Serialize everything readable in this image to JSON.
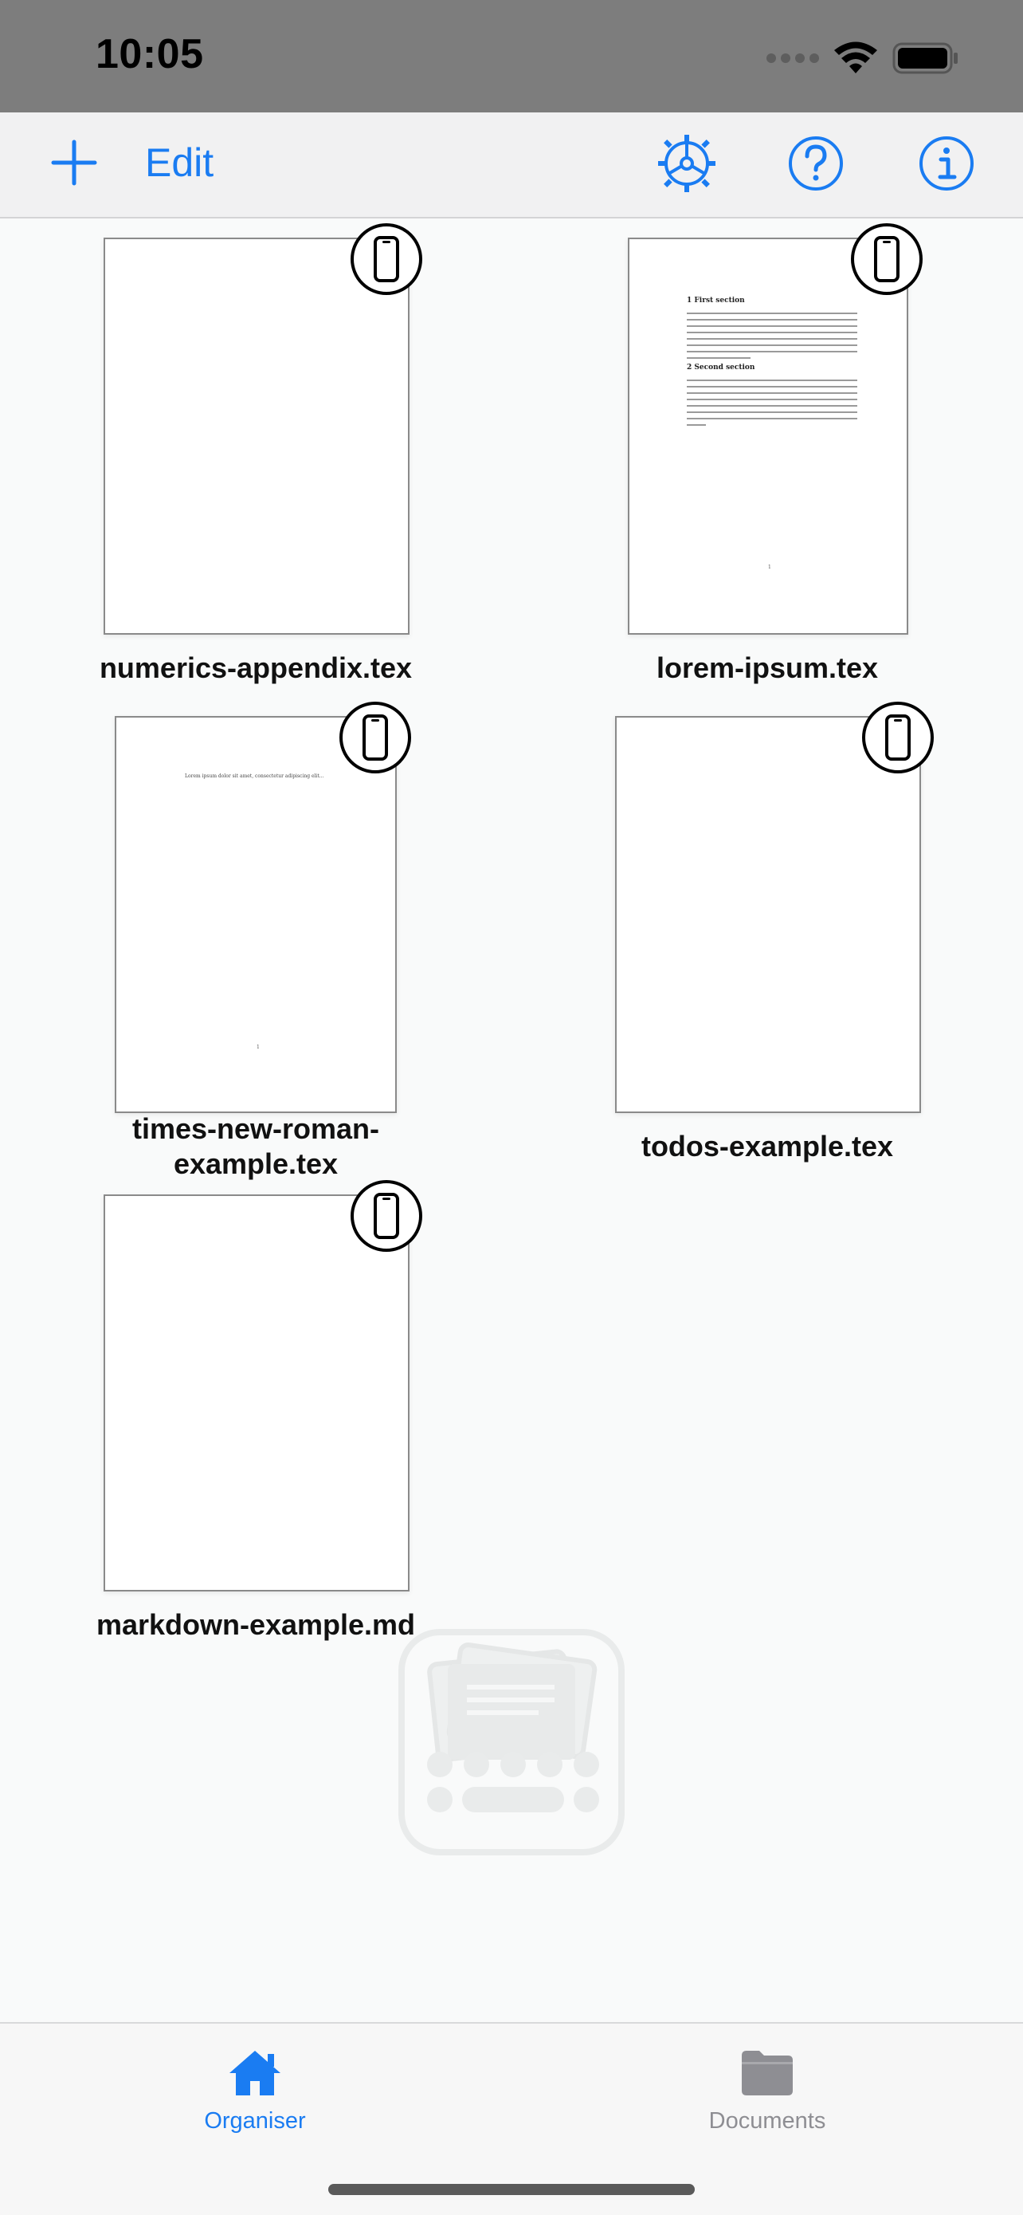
{
  "status_bar": {
    "time": "10:05"
  },
  "nav": {
    "edit_label": "Edit",
    "add_icon": "plus-icon",
    "settings_icon": "gear-icon",
    "help_icon": "question-circle-icon",
    "info_icon": "info-circle-icon",
    "accent_color": "#1a7cf2"
  },
  "documents": [
    {
      "name": "numerics-appendix.tex",
      "location_icon": "iphone-icon"
    },
    {
      "name": "lorem-ipsum.tex",
      "location_icon": "iphone-icon",
      "preview": {
        "heading1": "1   First section",
        "heading2": "2   Second section",
        "page_number": "1"
      }
    },
    {
      "name": "times-new-roman-example.tex",
      "location_icon": "iphone-icon",
      "preview": {
        "line": "Lorem ipsum dolor sit amet, consectetur adipiscing elit...",
        "page_number": "1"
      }
    },
    {
      "name": "todos-example.tex",
      "location_icon": "iphone-icon"
    },
    {
      "name": "markdown-example.md",
      "location_icon": "iphone-icon"
    }
  ],
  "tabs": [
    {
      "label": "Organiser",
      "icon": "house-icon",
      "active": true,
      "color": "#1a7cf2"
    },
    {
      "label": "Documents",
      "icon": "folder-icon",
      "active": false,
      "color": "#8e8e93"
    }
  ]
}
